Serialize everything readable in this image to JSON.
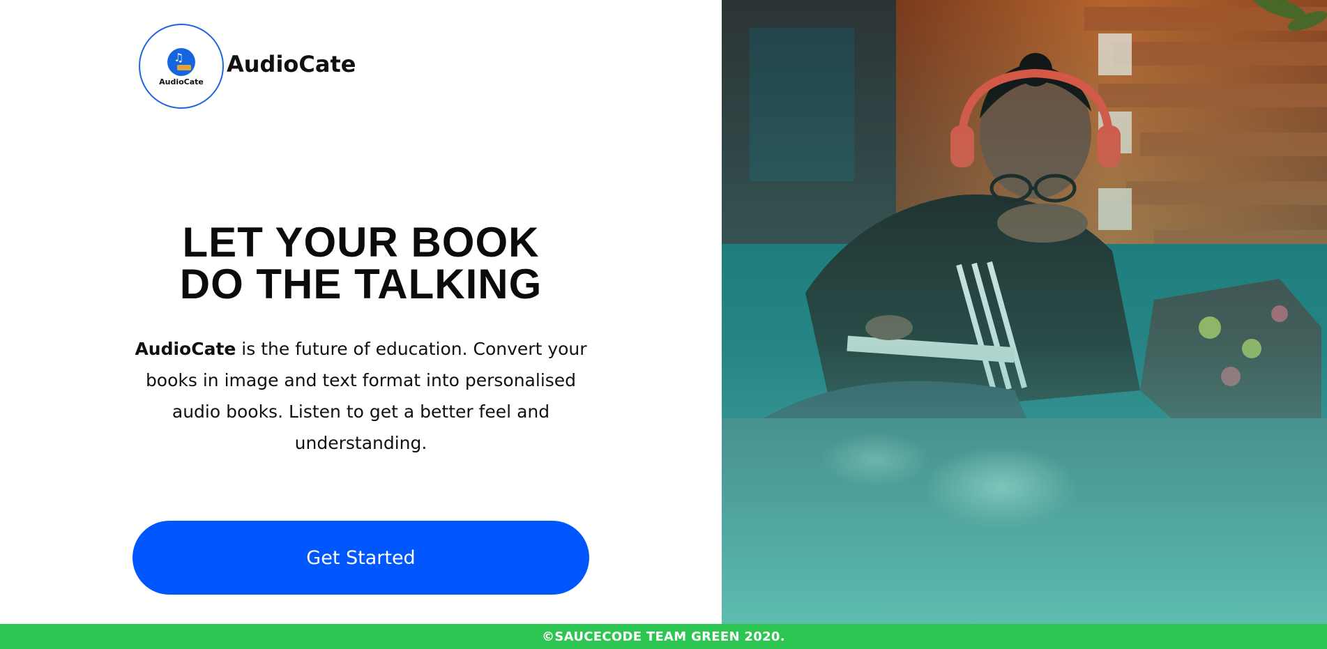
{
  "brand": {
    "logo_text": "AudioCate",
    "name": "AudioCate"
  },
  "hero": {
    "title_line1": "LET YOUR BOOK",
    "title_line2": "DO THE TALKING",
    "description_brand": "AudioCate",
    "description_rest": " is the future of education. Convert your books in image and text format into personalised audio books. Listen to get a better feel and understanding."
  },
  "cta": {
    "label": "Get Started"
  },
  "photo": {
    "subject": "person-with-headphones-writing-in-notebook"
  },
  "footer": {
    "text": "©SAUCECODE TEAM GREEN 2020."
  },
  "colors": {
    "accent": "#0057ff",
    "logo_border": "#1d63e6",
    "footer_bg": "#2dc653",
    "text": "#111111"
  }
}
